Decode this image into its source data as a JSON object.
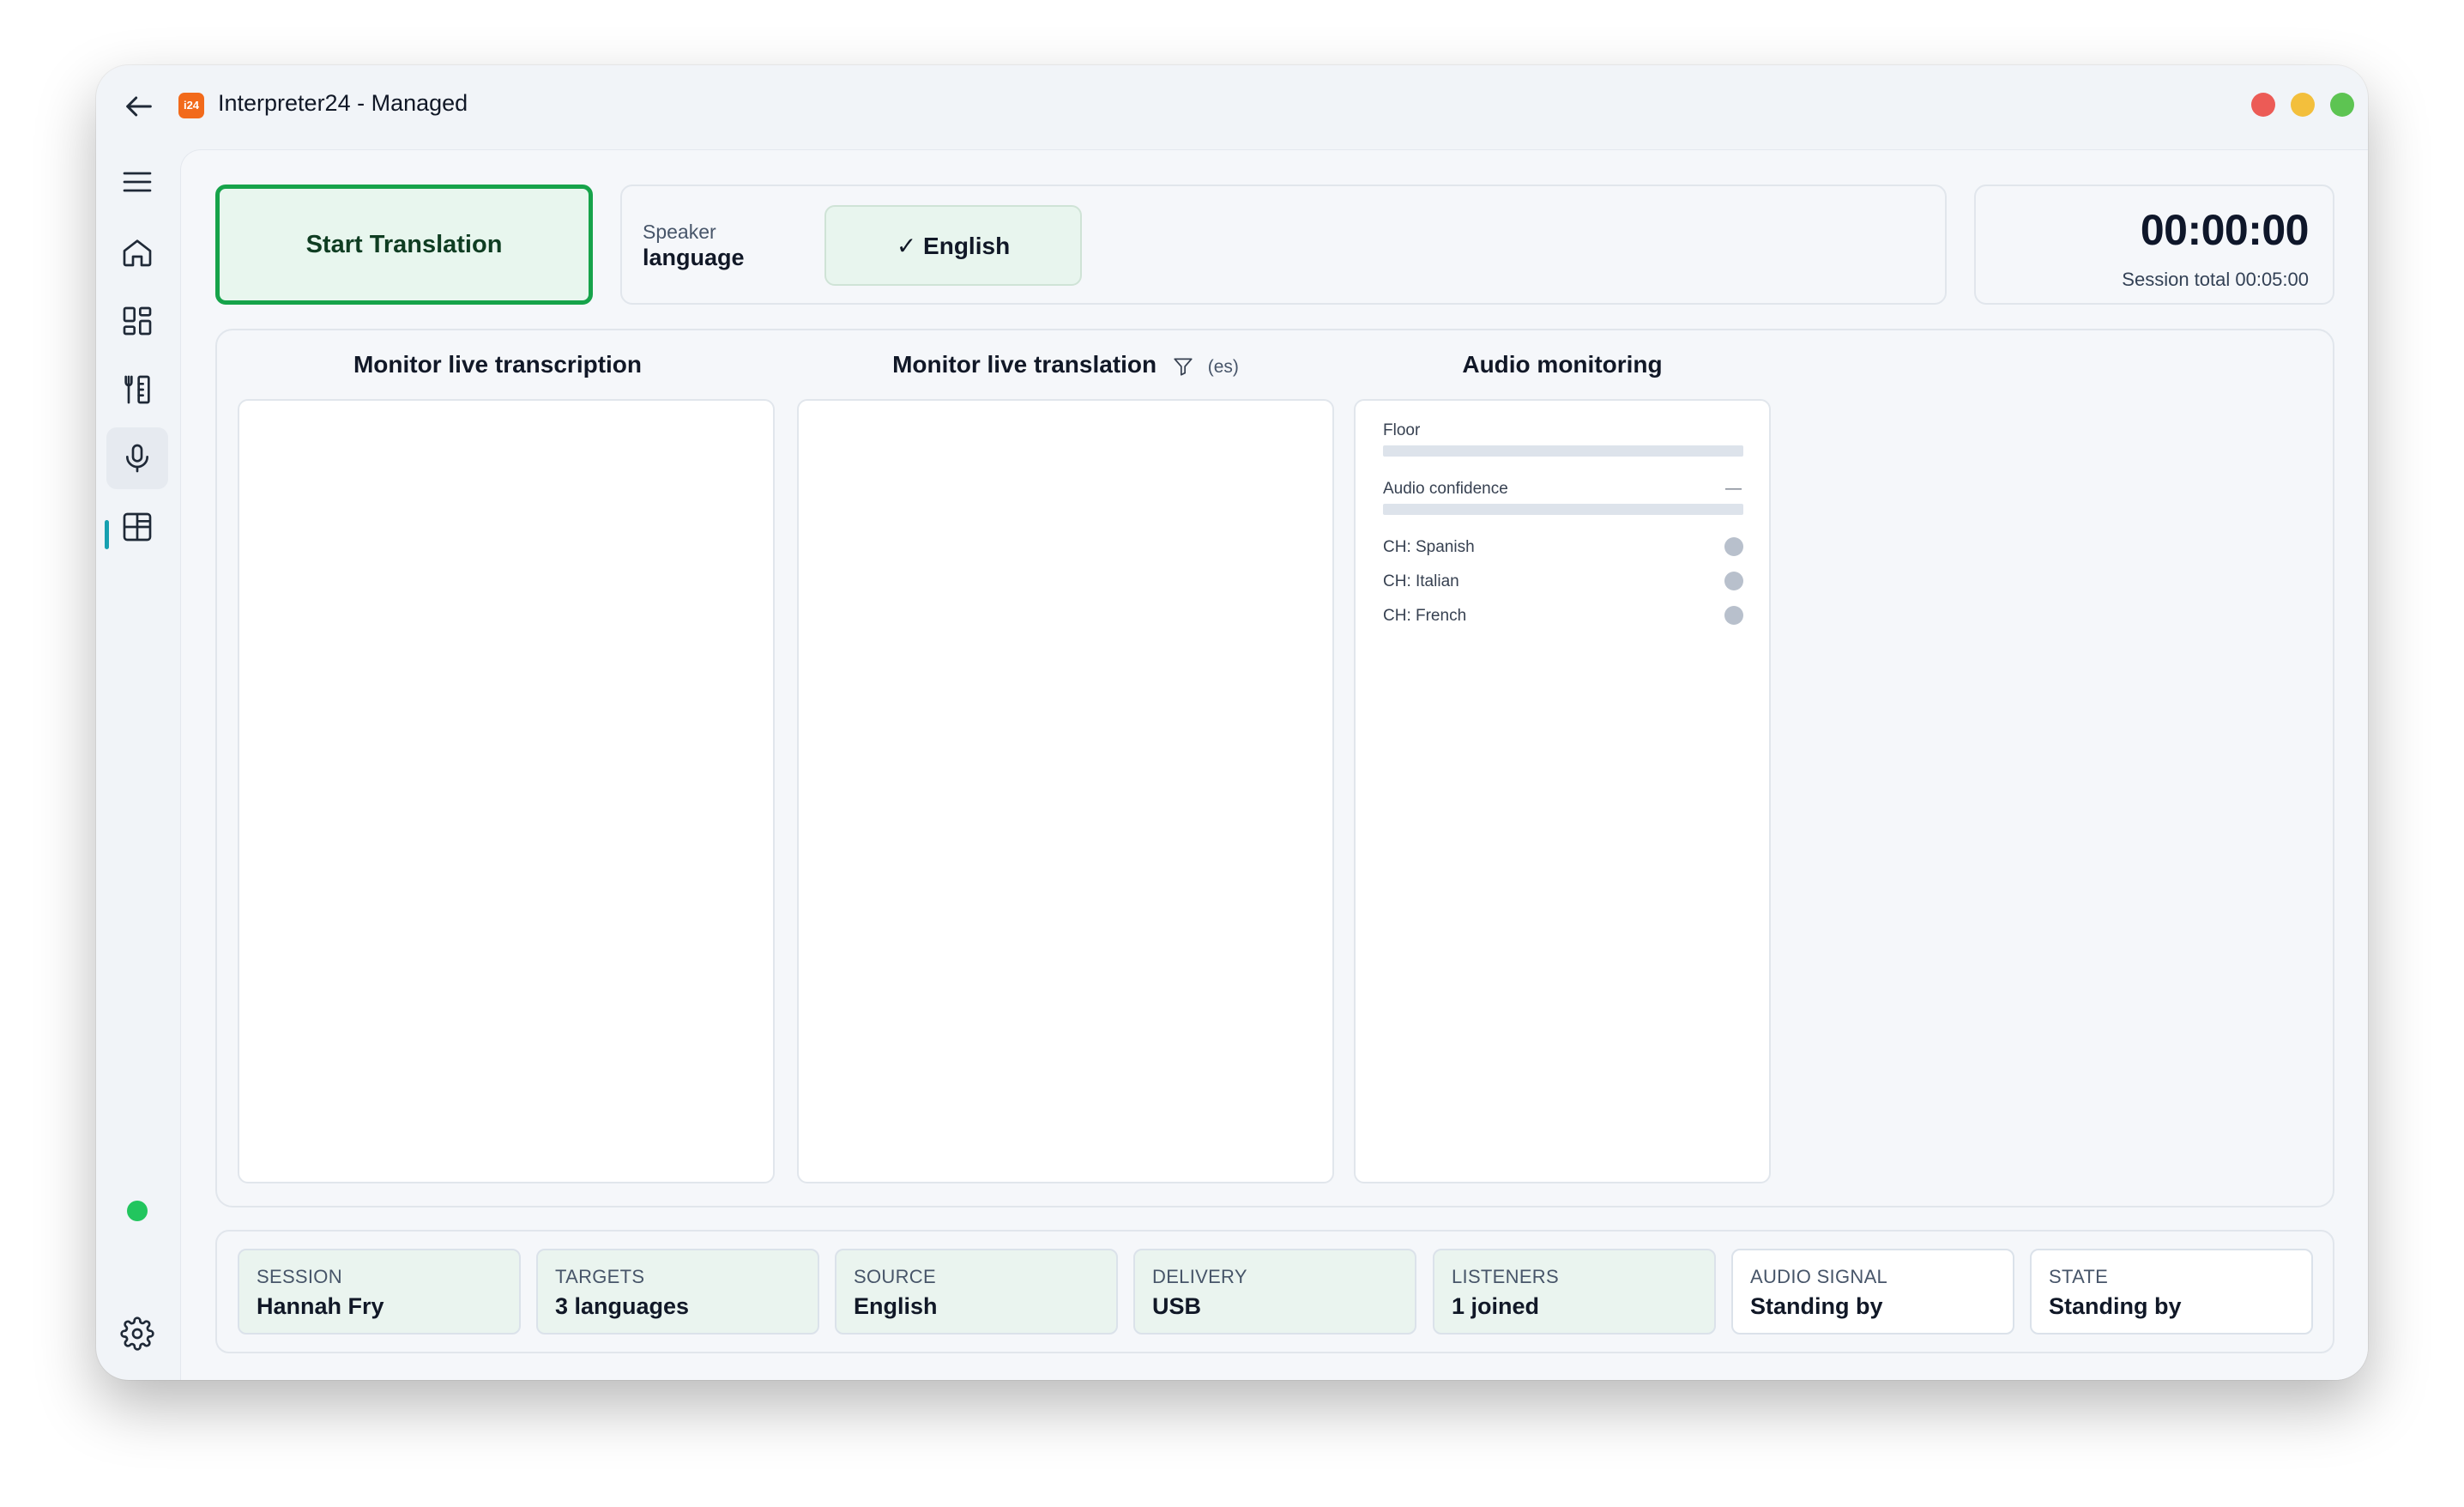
{
  "window": {
    "title": "Interpreter24 - Managed",
    "logo_text": "i24"
  },
  "sidebar": {
    "items": [
      {
        "name": "home",
        "icon": "home-icon"
      },
      {
        "name": "dashboard",
        "icon": "grid-icon"
      },
      {
        "name": "tools",
        "icon": "tools-icon"
      },
      {
        "name": "interpreter",
        "icon": "microphone-icon",
        "active": true
      },
      {
        "name": "layouts",
        "icon": "layout-icon"
      }
    ],
    "connection_status_color": "#22c55e"
  },
  "toolbar": {
    "start_label": "Start Translation",
    "speaker_label_top": "Speaker",
    "speaker_label_bottom": "language",
    "selected_language": "✓ English"
  },
  "timer": {
    "value": "00:00:00",
    "total": "Session total 00:05:00"
  },
  "monitor": {
    "transcription_title": "Monitor live transcription",
    "translation_title": "Monitor live translation",
    "translation_lang": "(es)",
    "audio_title": "Audio monitoring",
    "audio": {
      "floor_label": "Floor",
      "confidence_label": "Audio confidence",
      "confidence_value": "—",
      "channels": [
        "CH: Spanish",
        "CH: Italian",
        "CH: French"
      ]
    }
  },
  "status": [
    {
      "label": "SESSION",
      "value": "Hannah Fry"
    },
    {
      "label": "TARGETS",
      "value": "3 languages"
    },
    {
      "label": "SOURCE",
      "value": "English"
    },
    {
      "label": "DELIVERY",
      "value": "USB"
    },
    {
      "label": "LISTENERS",
      "value": "1 joined"
    },
    {
      "label": "AUDIO SIGNAL",
      "value": "Standing by"
    },
    {
      "label": "STATE",
      "value": "Standing by"
    }
  ],
  "colors": {
    "accent_green": "#16a34a",
    "active_marker": "#16a0b0"
  }
}
